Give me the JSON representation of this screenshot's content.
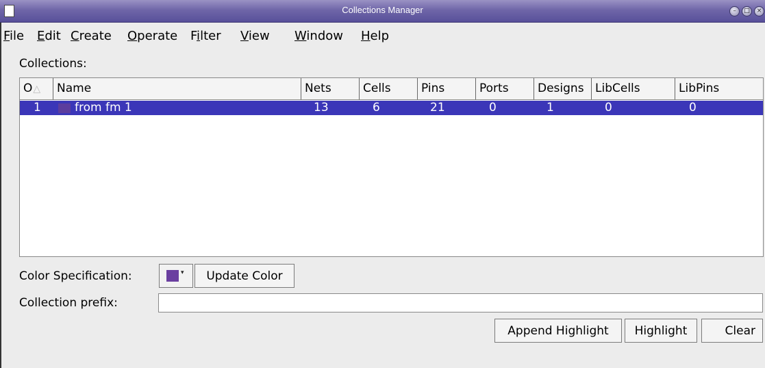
{
  "window": {
    "title": "Collections Manager",
    "minimize_symbol": "–",
    "maximize_symbol": "□",
    "close_symbol": "×"
  },
  "menu": [
    {
      "mnemonic": "F",
      "rest": "ile"
    },
    {
      "mnemonic": "E",
      "rest": "dit"
    },
    {
      "mnemonic": "C",
      "rest": "reate"
    },
    {
      "mnemonic": "O",
      "rest": "perate"
    },
    {
      "prefix": "F",
      "mnemonic": "i",
      "rest": "lter"
    },
    {
      "mnemonic": "V",
      "rest": "iew"
    },
    {
      "mnemonic": "W",
      "rest": "indow"
    },
    {
      "mnemonic": "H",
      "rest": "elp"
    }
  ],
  "collections_label": "Collections:",
  "table": {
    "columns": [
      "O",
      "Name",
      "Nets",
      "Cells",
      "Pins",
      "Ports",
      "Designs",
      "LibCells",
      "LibPins"
    ],
    "rows": [
      {
        "order": "1",
        "name": "from fm 1",
        "nets": "13",
        "cells": "6",
        "pins": "21",
        "ports": "0",
        "designs": "1",
        "libcells": "0",
        "libpins": "0",
        "selected": true,
        "swatch_color": "#5c3d9e"
      }
    ],
    "selected_row_color": "#3b36b8"
  },
  "color_spec": {
    "label": "Color Specification:",
    "current_color": "#6a3fa0",
    "dropdown_symbol": "▾",
    "update_label": "Update Color"
  },
  "prefix": {
    "label": "Collection prefix:",
    "value": ""
  },
  "actions": {
    "append_highlight": "Append Highlight",
    "highlight": "Highlight",
    "clear": "Clear"
  }
}
